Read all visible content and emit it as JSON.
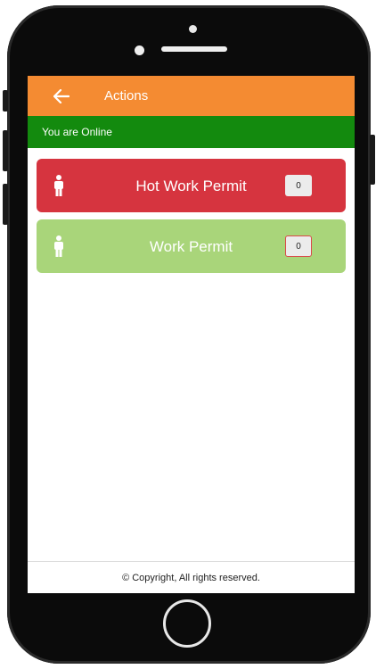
{
  "app_bar": {
    "title": "Actions",
    "back_icon": "arrow-left-icon",
    "color": "#f48b32"
  },
  "status": {
    "text": "You are Online",
    "color": "#138a0e"
  },
  "cards": [
    {
      "label": "Hot Work Permit",
      "count": "0",
      "icon": "person-icon",
      "color": "#d6343f"
    },
    {
      "label": "Work Permit",
      "count": "0",
      "icon": "person-icon",
      "color": "#a9d57a"
    }
  ],
  "footer": {
    "text": "© Copyright, All rights reserved."
  }
}
